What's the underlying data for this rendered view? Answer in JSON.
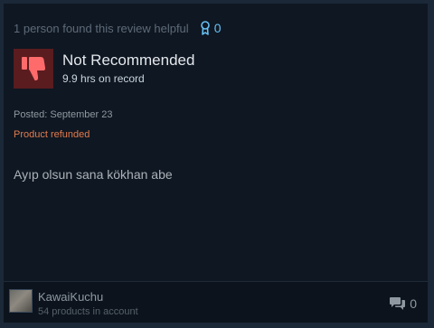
{
  "review": {
    "helpful_text": "1 person found this review helpful",
    "award_count": "0",
    "verdict": "Not Recommended",
    "hours": "9.9 hrs on record",
    "posted": "Posted: September 23",
    "refund_status": "Product refunded",
    "body": "Ayıp olsun sana kökhan abe",
    "comment_count": "0"
  },
  "author": {
    "name": "KawaiKuchu",
    "products": "54 products in account"
  },
  "icons": {
    "award": "award-ribbon-icon",
    "verdict": "thumbs-down-icon",
    "comments": "speech-bubbles-icon"
  },
  "colors": {
    "accent": "#66c0f4",
    "refund": "#e37b4d",
    "thumb_bg": "#5a1c1f",
    "thumb_fg": "#ff6b6b",
    "card_bg": "#0f1722"
  }
}
